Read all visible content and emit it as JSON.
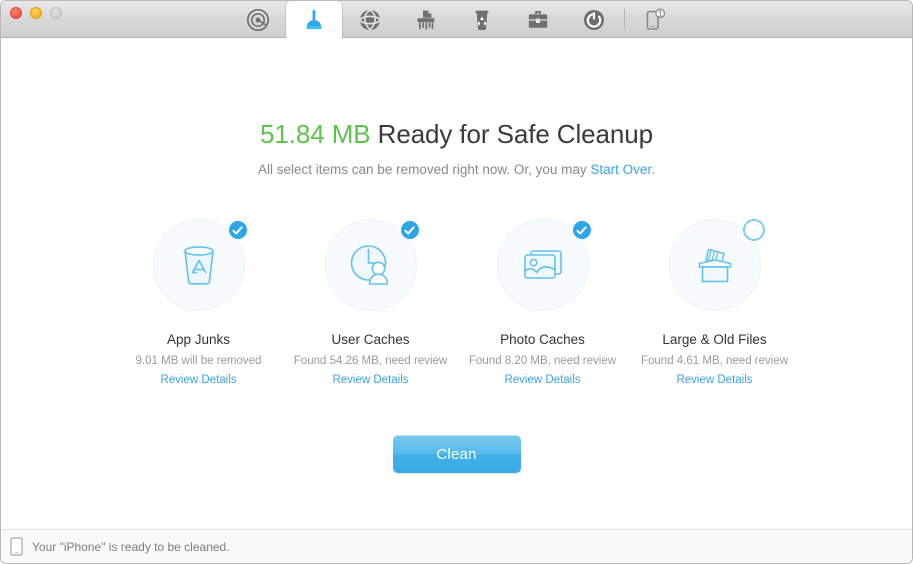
{
  "window": {
    "traffic_lights": [
      {
        "name": "close",
        "color": "#f4584b"
      },
      {
        "name": "minimize",
        "color": "#f8b521"
      },
      {
        "name": "zoom",
        "color": "#cfcfcf",
        "disabled": true
      }
    ]
  },
  "toolbar": {
    "tabs": [
      {
        "id": "scan",
        "icon": "radar-icon",
        "label": "Scan",
        "active": false
      },
      {
        "id": "clean",
        "icon": "plunger-icon",
        "label": "Clean",
        "active": true
      },
      {
        "id": "internet",
        "icon": "globe-icon",
        "label": "Internet",
        "active": false
      },
      {
        "id": "shredder",
        "icon": "shredder-icon",
        "label": "Shredder",
        "active": false
      },
      {
        "id": "trash",
        "icon": "trash-recycle-icon",
        "label": "Trash",
        "active": false
      },
      {
        "id": "toolkit",
        "icon": "toolbox-icon",
        "label": "Toolkit",
        "active": false
      },
      {
        "id": "optimize",
        "icon": "power-refresh-icon",
        "label": "Optimize",
        "active": false
      }
    ],
    "device_tab": {
      "id": "device",
      "icon": "phone-icon",
      "badge": "1",
      "label": "Device"
    },
    "accent_color": "#2da6e8"
  },
  "main": {
    "headline_size": "51.84 MB",
    "headline_rest": "Ready for Safe Cleanup",
    "headline_size_color": "#5cc44a",
    "subline_before": "All select items can be removed right now. Or, you may ",
    "subline_link": "Start Over",
    "subline_after": ".",
    "clean_button": "Clean",
    "categories": [
      {
        "id": "app-junks",
        "title": "App Junks",
        "detail": "9.01 MB will be removed",
        "link": "Review Details",
        "checked": true,
        "icon": "app-junks-icon"
      },
      {
        "id": "user-caches",
        "title": "User Caches",
        "detail": "Found 54.26 MB, need review",
        "link": "Review Details",
        "checked": true,
        "icon": "user-caches-icon"
      },
      {
        "id": "photo-caches",
        "title": "Photo Caches",
        "detail": "Found 8.20 MB, need review",
        "link": "Review Details",
        "checked": true,
        "icon": "photo-caches-icon"
      },
      {
        "id": "large-old-files",
        "title": "Large & Old Files",
        "detail": "Found 4.61 MB, need review",
        "link": "Review Details",
        "checked": false,
        "icon": "large-old-files-icon"
      }
    ]
  },
  "statusbar": {
    "icon": "device-phone-icon",
    "text": "Your \"iPhone\" is ready to be cleaned."
  }
}
